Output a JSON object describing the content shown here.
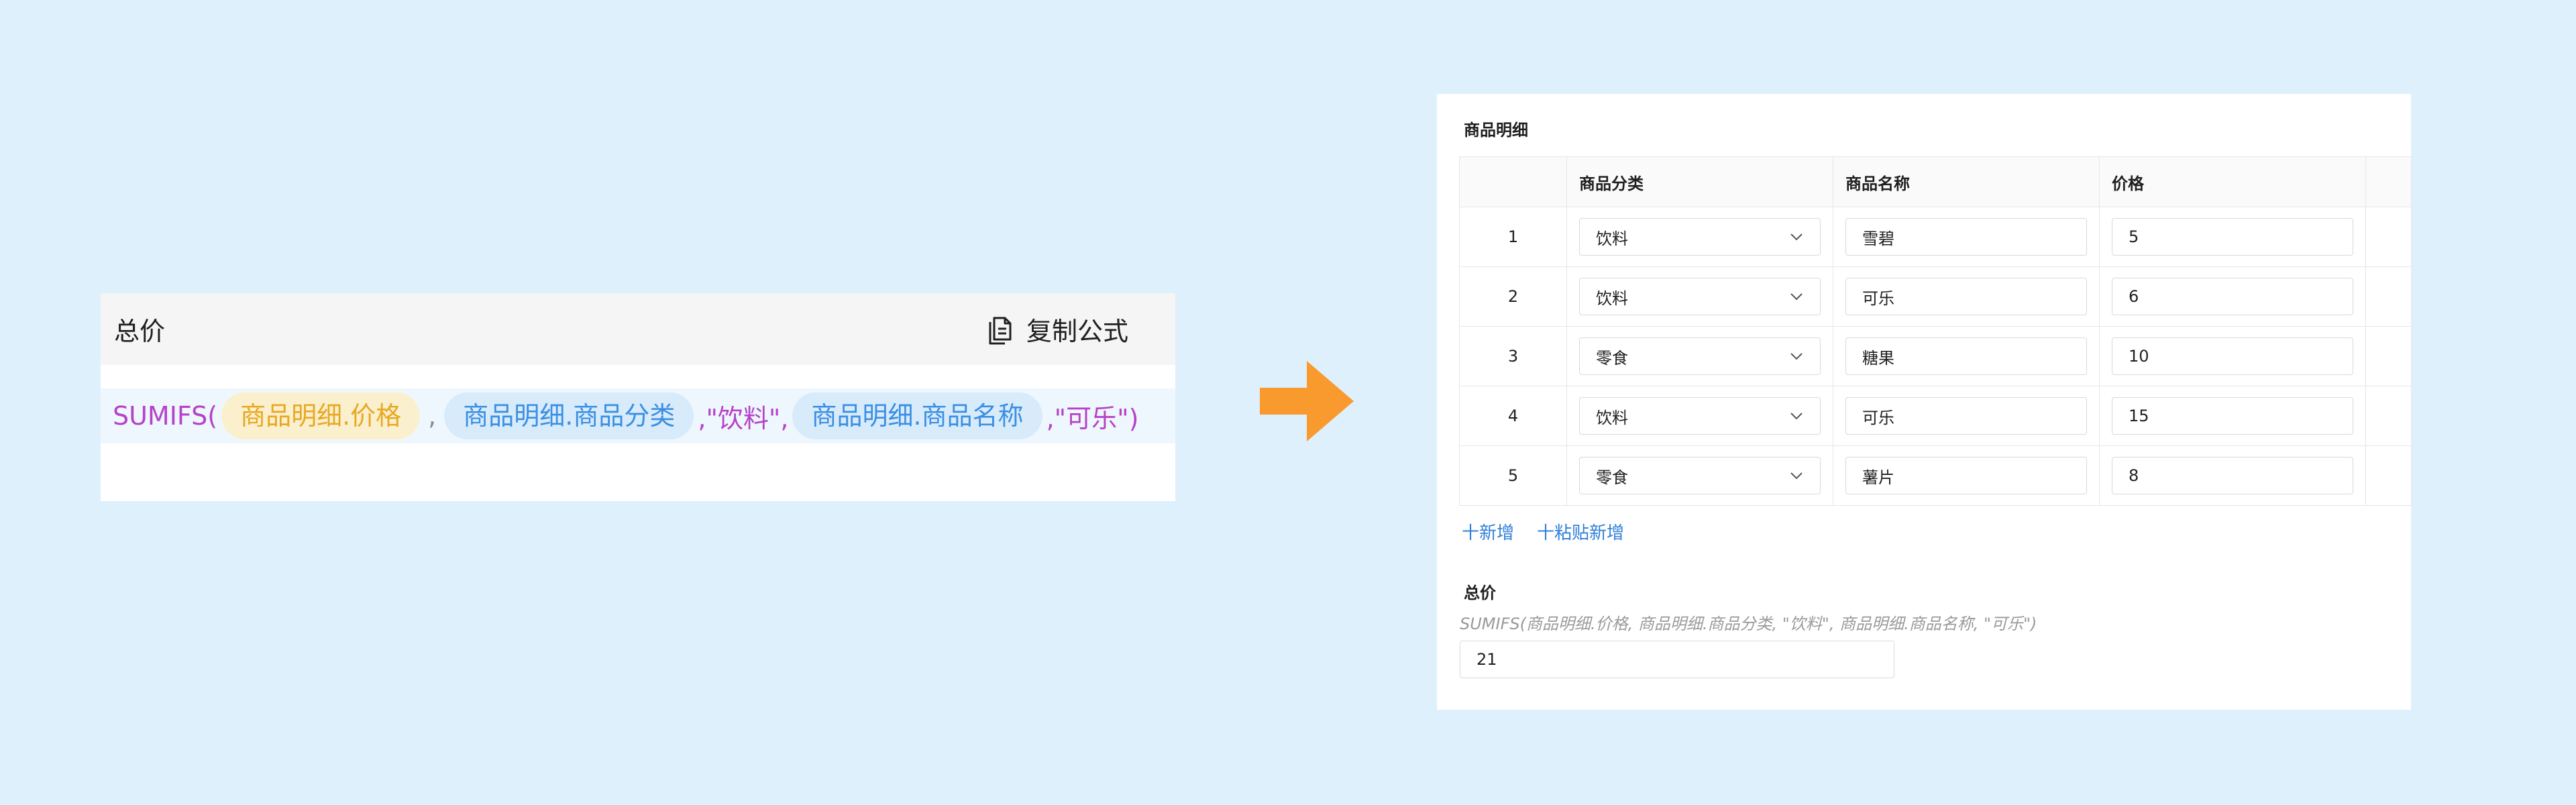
{
  "formula_card": {
    "title": "总价",
    "copy_label": "复制公式",
    "fn_open": "SUMIFS(",
    "chip_1": "商品明细.价格",
    "sep_1": ",",
    "chip_2": "商品明细.商品分类",
    "literal_1": ",\"饮料\",",
    "chip_3": "商品明细.商品名称",
    "literal_2": ",\"可乐\")"
  },
  "colors": {
    "background": "#dff0fd",
    "function_text": "#b642c8",
    "chip_yellow_bg": "#fbf0cd",
    "chip_yellow_text": "#e8a823",
    "chip_blue_bg": "#d8ebfb",
    "chip_blue_text": "#3b8fe3",
    "arrow": "#f99a2e",
    "link": "#2f7fd8"
  },
  "form": {
    "section_title": "商品明细",
    "columns": [
      "商品分类",
      "商品名称",
      "价格"
    ],
    "rows": [
      {
        "index": "1",
        "category": "饮料",
        "name": "雪碧",
        "price": "5"
      },
      {
        "index": "2",
        "category": "饮料",
        "name": "可乐",
        "price": "6"
      },
      {
        "index": "3",
        "category": "零食",
        "name": "糖果",
        "price": "10"
      },
      {
        "index": "4",
        "category": "饮料",
        "name": "可乐",
        "price": "15"
      },
      {
        "index": "5",
        "category": "零食",
        "name": "薯片",
        "price": "8"
      }
    ],
    "add_label": "十新增",
    "paste_add_label": "十粘贴新增",
    "total_label": "总价",
    "total_formula": "SUMIFS(商品明细.价格, 商品明细.商品分类, \"饮料\", 商品明细.商品名称, \"可乐\")",
    "total_value": "21"
  }
}
